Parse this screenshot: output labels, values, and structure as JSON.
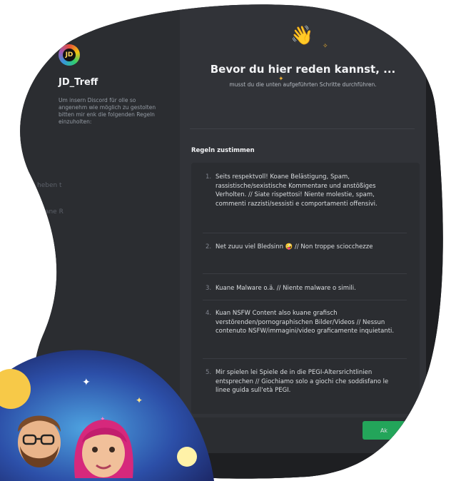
{
  "server": {
    "name": "JD_Treff",
    "icon": "server-icon",
    "description": "Um insern Discord für olle so angenehm wie möglich zu gestolten bitten mir enk die folgenden Regeln einzuholten:"
  },
  "background_fragments": {
    "a": "heben t",
    "b": "Koane R",
    "c": "nse"
  },
  "onboarding": {
    "wave_icon": "waving-hand-icon",
    "title": "Bevor du hier reden kannst, ...",
    "subtitle": "musst du die unten aufgeführten Schritte durchführen."
  },
  "rules": {
    "heading": "Regeln zustimmen",
    "items": [
      {
        "num": "1.",
        "text": "Seits respektvoll! Koane Belästigung, Spam, rassistische/sexistische Kommentare und anstößiges Verholten. // Siate rispettosi! Niente molestie, spam, commenti razzisti/sessisti e comportamenti offensivi."
      },
      {
        "num": "2.",
        "text": "Net zuuu viel Bledsinn 🤪 // Non troppe sciocchezze"
      },
      {
        "num": "3.",
        "text": "Kuane Malware o.ä. // Niente malware o simili."
      },
      {
        "num": "4.",
        "text": "Kuan NSFW  Content also kuane grafisch verstörenden/pornographischen Bilder/Videos // Nessun contenuto NSFW/immagini/video graficamente inquietanti."
      },
      {
        "num": "5.",
        "text": "Mir spielen lei Spiele de in die PEGI-Altersrichtlinien entsprechen // Giochiamo solo a giochi che soddisfano le linee guida sull'età PEGI."
      }
    ]
  },
  "footer": {
    "accept_label": "Ak"
  },
  "colors": {
    "accent_green": "#23a55a",
    "bg_dark": "#1e1f22",
    "panel": "#2b2d31",
    "main": "#313338"
  }
}
